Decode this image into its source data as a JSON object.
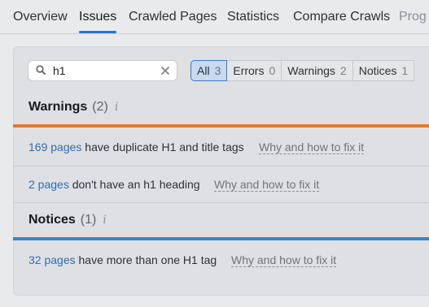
{
  "tabs": [
    {
      "label": "Overview"
    },
    {
      "label": "Issues",
      "active": true
    },
    {
      "label": "Crawled Pages"
    },
    {
      "label": "Statistics"
    },
    {
      "label": "Compare Crawls"
    },
    {
      "label": "Prog"
    }
  ],
  "search": {
    "value": "h1",
    "icon": "search-icon",
    "clear_icon": "close-icon"
  },
  "filters": [
    {
      "label": "All",
      "count": "3",
      "active": true
    },
    {
      "label": "Errors",
      "count": "0"
    },
    {
      "label": "Warnings",
      "count": "2"
    },
    {
      "label": "Notices",
      "count": "1"
    }
  ],
  "warnings": {
    "title": "Warnings",
    "count": "(2)",
    "info": "i",
    "accent": "#e07a2e",
    "items": [
      {
        "link": "169 pages",
        "text": " have duplicate H1 and title tags",
        "fix": "Why and how to fix it"
      },
      {
        "link": "2 pages",
        "text": " don't have an h1 heading",
        "fix": "Why and how to fix it"
      }
    ]
  },
  "notices": {
    "title": "Notices",
    "count": "(1)",
    "info": "i",
    "accent": "#2b8bd6",
    "items": [
      {
        "link": "32 pages",
        "text": " have more than one H1 tag",
        "fix": "Why and how to fix it"
      }
    ]
  }
}
